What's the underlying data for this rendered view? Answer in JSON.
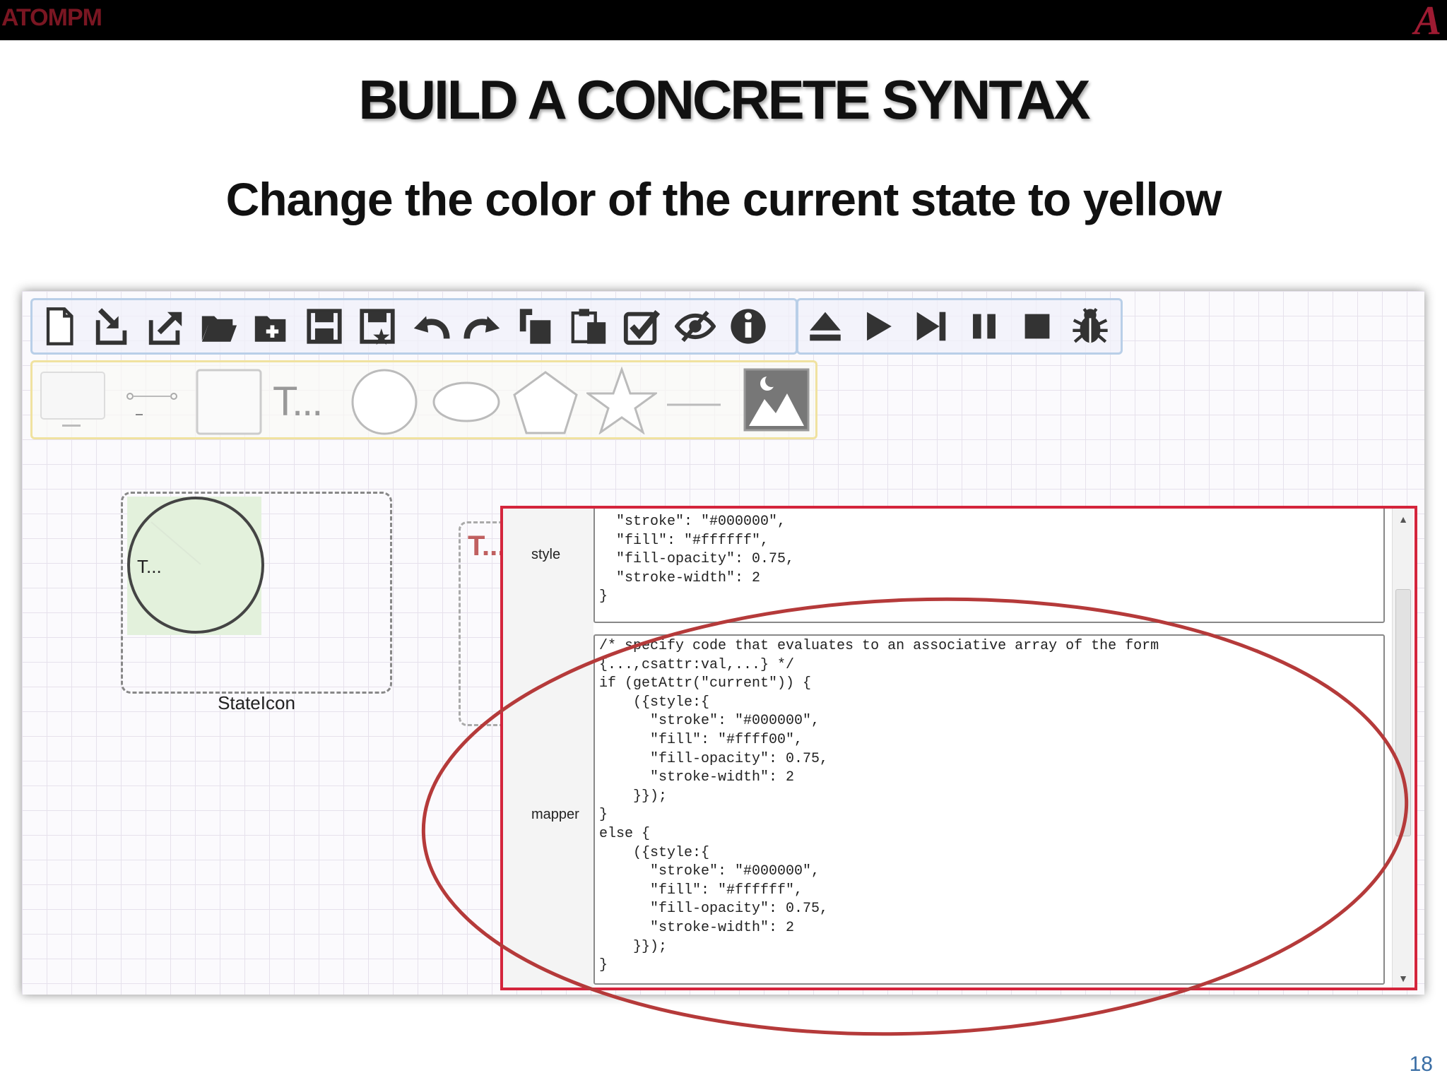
{
  "header": {
    "logo_text": "ATOMPM",
    "seal_text": "A"
  },
  "slide": {
    "title": "BUILD A CONCRETE SYNTAX",
    "subtitle": "Change the color of the current state to yellow",
    "page_number": "18"
  },
  "toolbar": {
    "main_icons": [
      "new-file-icon",
      "import-icon",
      "export-icon",
      "open-folder-icon",
      "add-folder-icon",
      "save-icon",
      "save-as-icon",
      "undo-icon",
      "redo-icon",
      "copy-icon",
      "paste-icon",
      "validate-icon",
      "toggle-visibility-icon",
      "info-icon"
    ],
    "run_icons": [
      "eject-icon",
      "play-icon",
      "step-icon",
      "pause-icon",
      "stop-icon",
      "debug-bug-icon"
    ]
  },
  "palette": {
    "text_item_label": "T...",
    "items": [
      "rectangle-tool",
      "link-tool",
      "square-tool",
      "text-tool",
      "circle-tool",
      "ellipse-tool",
      "pentagon-tool",
      "star-tool",
      "line-tool",
      "image-tool"
    ]
  },
  "canvas": {
    "state_icon_text": "T...",
    "state_icon_caption": "StateIcon",
    "text_icon_label": "T..."
  },
  "dialog": {
    "style_label": "style",
    "mapper_label": "mapper",
    "style_code": "  \"stroke\": \"#000000\",\n  \"fill\": \"#ffffff\",\n  \"fill-opacity\": 0.75,\n  \"stroke-width\": 2\n}",
    "mapper_code": "/* specify code that evaluates to an associative array of the form\n{...,csattr:val,...} */\nif (getAttr(\"current\")) {\n    ({style:{\n      \"stroke\": \"#000000\",\n      \"fill\": \"#ffff00\",\n      \"fill-opacity\": 0.75,\n      \"stroke-width\": 2\n    }});\n}\nelse {\n    ({style:{\n      \"stroke\": \"#000000\",\n      \"fill\": \"#ffffff\",\n      \"fill-opacity\": 0.75,\n      \"stroke-width\": 2\n    }});\n}"
  },
  "colors": {
    "highlight_ellipse": "#b53a3a",
    "dialog_border": "#d4253c",
    "toolbar_border": "#b9cfe8",
    "palette_border": "#f0e2a0",
    "page_number": "#3a6ea5",
    "brand": "#9e1b32"
  }
}
